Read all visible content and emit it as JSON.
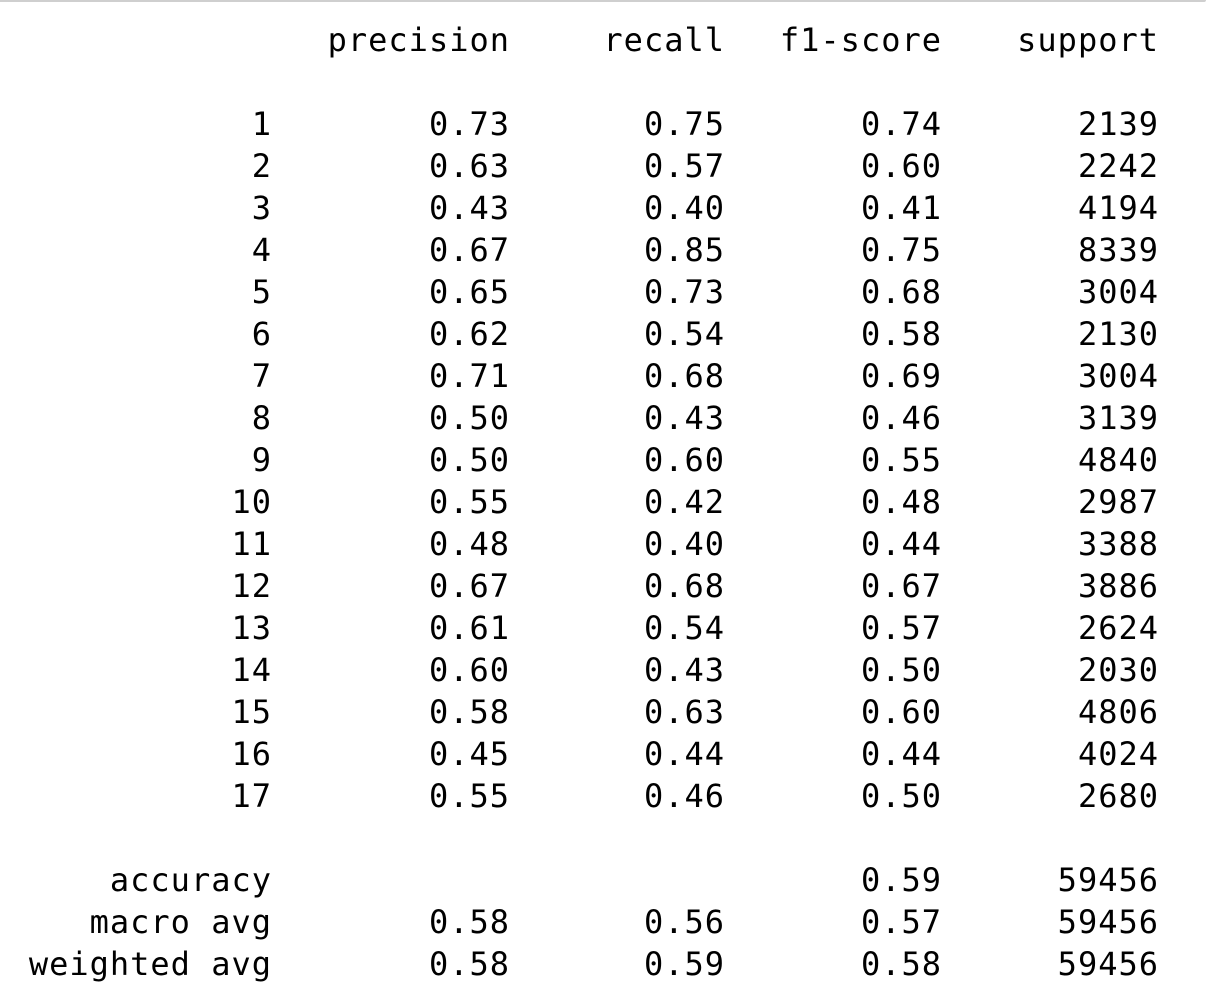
{
  "report": {
    "header": {
      "label": "",
      "precision": "precision",
      "recall": "recall",
      "f1_score": "f1-score",
      "support": "support"
    },
    "class_rows": [
      {
        "label": "1",
        "precision": "0.73",
        "recall": "0.75",
        "f1_score": "0.74",
        "support": "2139"
      },
      {
        "label": "2",
        "precision": "0.63",
        "recall": "0.57",
        "f1_score": "0.60",
        "support": "2242"
      },
      {
        "label": "3",
        "precision": "0.43",
        "recall": "0.40",
        "f1_score": "0.41",
        "support": "4194"
      },
      {
        "label": "4",
        "precision": "0.67",
        "recall": "0.85",
        "f1_score": "0.75",
        "support": "8339"
      },
      {
        "label": "5",
        "precision": "0.65",
        "recall": "0.73",
        "f1_score": "0.68",
        "support": "3004"
      },
      {
        "label": "6",
        "precision": "0.62",
        "recall": "0.54",
        "f1_score": "0.58",
        "support": "2130"
      },
      {
        "label": "7",
        "precision": "0.71",
        "recall": "0.68",
        "f1_score": "0.69",
        "support": "3004"
      },
      {
        "label": "8",
        "precision": "0.50",
        "recall": "0.43",
        "f1_score": "0.46",
        "support": "3139"
      },
      {
        "label": "9",
        "precision": "0.50",
        "recall": "0.60",
        "f1_score": "0.55",
        "support": "4840"
      },
      {
        "label": "10",
        "precision": "0.55",
        "recall": "0.42",
        "f1_score": "0.48",
        "support": "2987"
      },
      {
        "label": "11",
        "precision": "0.48",
        "recall": "0.40",
        "f1_score": "0.44",
        "support": "3388"
      },
      {
        "label": "12",
        "precision": "0.67",
        "recall": "0.68",
        "f1_score": "0.67",
        "support": "3886"
      },
      {
        "label": "13",
        "precision": "0.61",
        "recall": "0.54",
        "f1_score": "0.57",
        "support": "2624"
      },
      {
        "label": "14",
        "precision": "0.60",
        "recall": "0.43",
        "f1_score": "0.50",
        "support": "2030"
      },
      {
        "label": "15",
        "precision": "0.58",
        "recall": "0.63",
        "f1_score": "0.60",
        "support": "4806"
      },
      {
        "label": "16",
        "precision": "0.45",
        "recall": "0.44",
        "f1_score": "0.44",
        "support": "4024"
      },
      {
        "label": "17",
        "precision": "0.55",
        "recall": "0.46",
        "f1_score": "0.50",
        "support": "2680"
      }
    ],
    "summary_rows": [
      {
        "label": "accuracy",
        "precision": "",
        "recall": "",
        "f1_score": "0.59",
        "support": "59456"
      },
      {
        "label": "macro avg",
        "precision": "0.58",
        "recall": "0.56",
        "f1_score": "0.57",
        "support": "59456"
      },
      {
        "label": "weighted avg",
        "precision": "0.58",
        "recall": "0.59",
        "f1_score": "0.58",
        "support": "59456"
      }
    ]
  }
}
